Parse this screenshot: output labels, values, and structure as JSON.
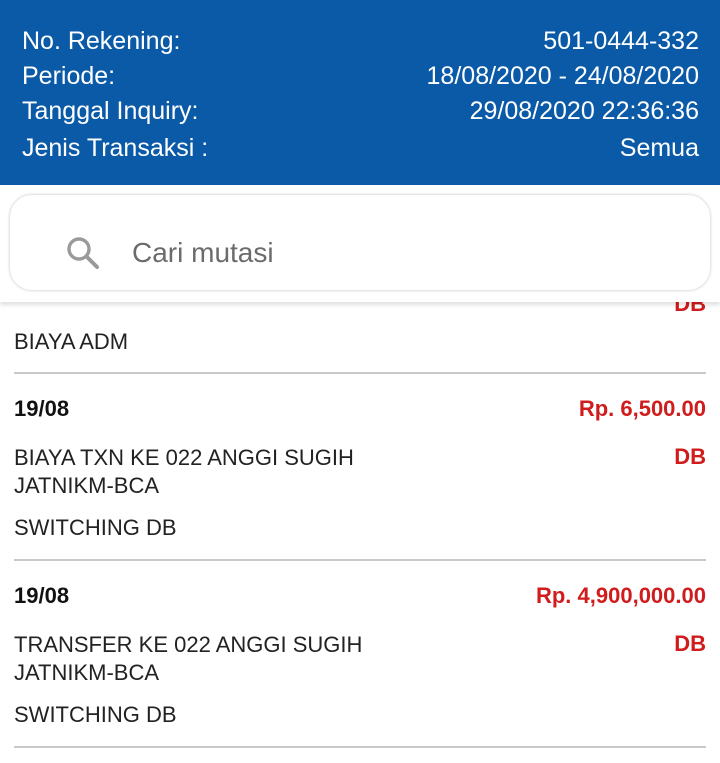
{
  "header": {
    "rekening_label": "No. Rekening:",
    "rekening_value": "501-0444-332",
    "periode_label": "Periode:",
    "periode_value": "18/08/2020 - 24/08/2020",
    "inquiry_label": "Tanggal Inquiry:",
    "inquiry_value": "29/08/2020 22:36:36",
    "jenis_label": "Jenis Transaksi :",
    "jenis_value": "Semua"
  },
  "search": {
    "placeholder": "Cari mutasi"
  },
  "colors": {
    "header_bg": "#0b5aa7",
    "debit": "#d01c1c"
  },
  "transactions": [
    {
      "partial_type": "DB",
      "desc": "BIAYA ADM"
    },
    {
      "date": "19/08",
      "amount": "Rp. 6,500.00",
      "desc_line1": "BIAYA TXN  KE 022 ANGGI SUGIH",
      "desc_line2": "JATNIKM-BCA",
      "type": "DB",
      "desc_line3": "SWITCHING DB"
    },
    {
      "date": "19/08",
      "amount": "Rp. 4,900,000.00",
      "desc_line1": "TRANSFER   KE 022 ANGGI SUGIH",
      "desc_line2": "JATNIKM-BCA",
      "type": "DB",
      "desc_line3": "SWITCHING DB"
    }
  ]
}
